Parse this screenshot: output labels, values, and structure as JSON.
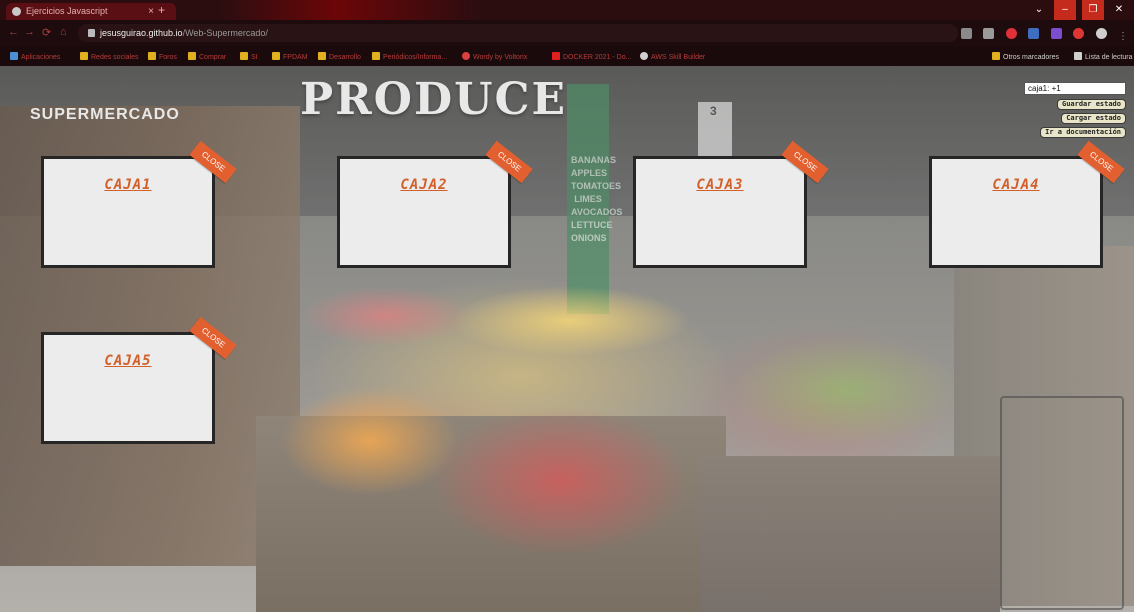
{
  "browser": {
    "tab_title": "Ejercicios Javascript",
    "tab_close": "×",
    "new_tab": "+",
    "url_host": "jesusguirao.github.io",
    "url_path": "/Web-Supermercado/",
    "nav": {
      "back": "←",
      "forward": "→",
      "reload": "⟳",
      "home": "⌂"
    },
    "window_controls": {
      "menu": "⌄",
      "minimize": "–",
      "maximize": "❐",
      "close": "✕"
    }
  },
  "bookmarks": {
    "apps": "Aplicaciones",
    "items": [
      "Redes sociales",
      "Foros",
      "Comprar",
      "SI",
      "FPDAM",
      "Desarrollo",
      "Periódicos/Informa...",
      "Wordy by Voltorix",
      "DOCKER 2021 - Do...",
      "AWS Skill Builder"
    ],
    "other": "Otros marcadores",
    "reading_list": "Lista de lectura"
  },
  "background": {
    "produce_sign": "PRODUCE",
    "store_sign": "SUPERMERCADO",
    "aisle_number": "3",
    "column_sign": [
      "BANANAS",
      "APPLES",
      "TOMATOES",
      "LIMES",
      "AVOCADOS",
      "LETTUCE",
      "ONIONS"
    ]
  },
  "boxes": [
    {
      "label": "CAJA1",
      "close": "CLOSE"
    },
    {
      "label": "CAJA2",
      "close": "CLOSE"
    },
    {
      "label": "CAJA3",
      "close": "CLOSE"
    },
    {
      "label": "CAJA4",
      "close": "CLOSE"
    },
    {
      "label": "CAJA5",
      "close": "CLOSE"
    }
  ],
  "controls": {
    "state_value": "caja1: +1",
    "save_label": "Guardar estado",
    "load_label": "Cargar estado",
    "docs_label": "Ir a documentación"
  },
  "colors": {
    "box_label": "#d2602b",
    "close_badge": "#e2602f",
    "box_bg": "#ececec",
    "button_bg": "#e8e5c8"
  }
}
